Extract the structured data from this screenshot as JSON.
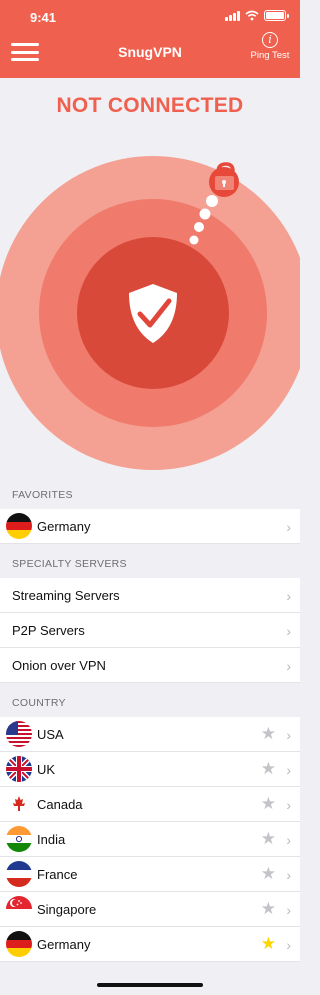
{
  "status_bar": {
    "time": "9:41"
  },
  "header": {
    "app_title": "SnugVPN",
    "ping_label": "Ping Test",
    "ping_icon_glyph": "i"
  },
  "connection": {
    "status": "NOT CONNECTED"
  },
  "favorites": {
    "header": "FAVORITES",
    "items": [
      {
        "label": "Germany",
        "flag": "germany-flag"
      }
    ]
  },
  "specialty": {
    "header": "SPECIALTY SERVERS",
    "items": [
      {
        "label": "Streaming Servers"
      },
      {
        "label": "P2P Servers"
      },
      {
        "label": "Onion over VPN"
      }
    ]
  },
  "country": {
    "header": "COUNTRY",
    "items": [
      {
        "label": "USA",
        "flag": "usa-flag",
        "starred": false
      },
      {
        "label": "UK",
        "flag": "uk-flag",
        "starred": false
      },
      {
        "label": "Canada",
        "flag": "canada-flag",
        "starred": false
      },
      {
        "label": "India",
        "flag": "india-flag",
        "starred": false
      },
      {
        "label": "France",
        "flag": "france-flag",
        "starred": false
      },
      {
        "label": "Singapore",
        "flag": "singapore-flag",
        "starred": false
      },
      {
        "label": "Germany",
        "flag": "germany-flag",
        "starred": true
      }
    ]
  },
  "glyphs": {
    "chevron": "›",
    "star": "★"
  },
  "colors": {
    "brand": "#f0604f",
    "star_on": "#ffd500",
    "star_off": "#c3c3c8"
  }
}
